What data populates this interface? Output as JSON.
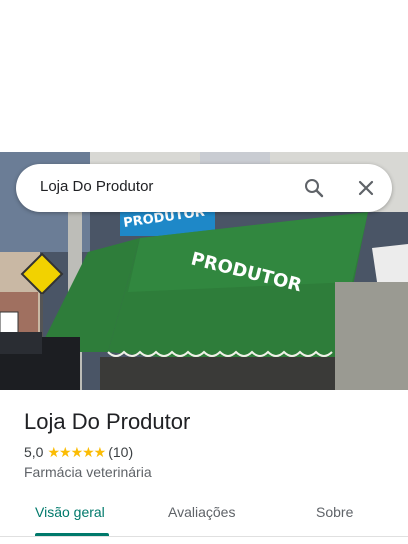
{
  "search": {
    "query": "Loja Do Produtor"
  },
  "icons": {
    "search": "search-icon",
    "close": "close-icon"
  },
  "photo": {
    "awning_text": "PRODUTOR",
    "sign_text": "PRODUTOR"
  },
  "place": {
    "name": "Loja Do Produtor",
    "rating": "5,0",
    "stars": "★★★★★",
    "review_count": "(10)",
    "category": "Farmácia veterinária"
  },
  "tabs": [
    {
      "label": "Visão geral",
      "active": true
    },
    {
      "label": "Avaliações",
      "active": false
    },
    {
      "label": "Sobre",
      "active": false
    }
  ],
  "colors": {
    "accent": "#00796b",
    "star": "#fbbc04",
    "awning": "#2e7d3a"
  }
}
